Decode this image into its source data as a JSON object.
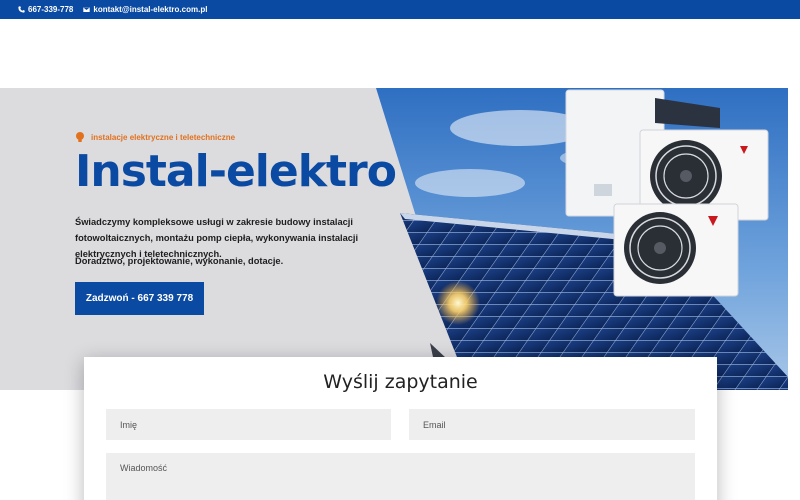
{
  "topbar": {
    "phone": "667-339-778",
    "email": "kontakt@instal-elektro.com.pl",
    "bg_color": "#0b4aa2"
  },
  "hero": {
    "tagline": "instalacje elektryczne i teletechniczne",
    "tagline_icon": "lightbulb-icon",
    "title": "Instal-elektro",
    "description": "Świadczymy kompleksowe usługi w zakresie budowy instalacji fotowoltaicznych, montażu pomp ciepła, wykonywania instalacji elektrycznych i teletechnicznych.",
    "subtext": "Doradztwo, projektowanie, wykonanie, dotacje.",
    "cta_label": "Zadzwoń - 667 339 778",
    "accent_color": "#0b4aa2",
    "tagline_color": "#e2711d"
  },
  "form": {
    "title": "Wyślij zapytanie",
    "name_placeholder": "Imię",
    "email_placeholder": "Email",
    "message_placeholder": "Wiadomość"
  }
}
